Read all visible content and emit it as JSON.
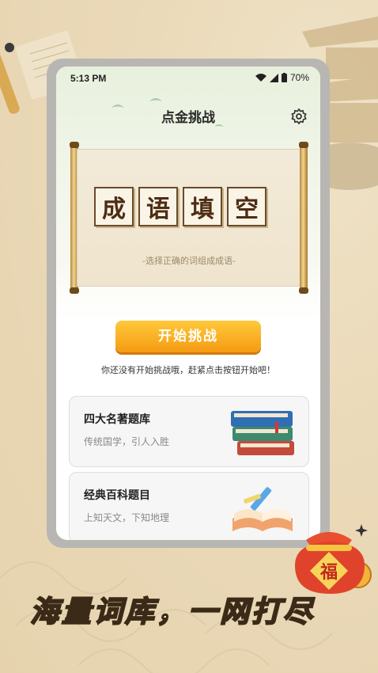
{
  "statusbar": {
    "time": "5:13 PM",
    "battery": "70%"
  },
  "header": {
    "title": "点金挑战"
  },
  "banner": {
    "tiles": [
      "成",
      "语",
      "填",
      "空"
    ],
    "subtitle": "-选择正确的词组成成语-"
  },
  "start_button": {
    "label": "开始挑战"
  },
  "hint": "你还没有开始挑战哦，赶紧点击按钮开始吧！",
  "categories": [
    {
      "title": "四大名著题库",
      "subtitle": "传统国学，引人入胜"
    },
    {
      "title": "经典百科题目",
      "subtitle": "上知天文，下知地理"
    }
  ],
  "slogan": "海量词库，一网打尽",
  "lucky_bag_char": "福",
  "colors": {
    "accent": "#f5a31a",
    "tile_border": "#6a4a2a",
    "background": "#ead9b8"
  }
}
